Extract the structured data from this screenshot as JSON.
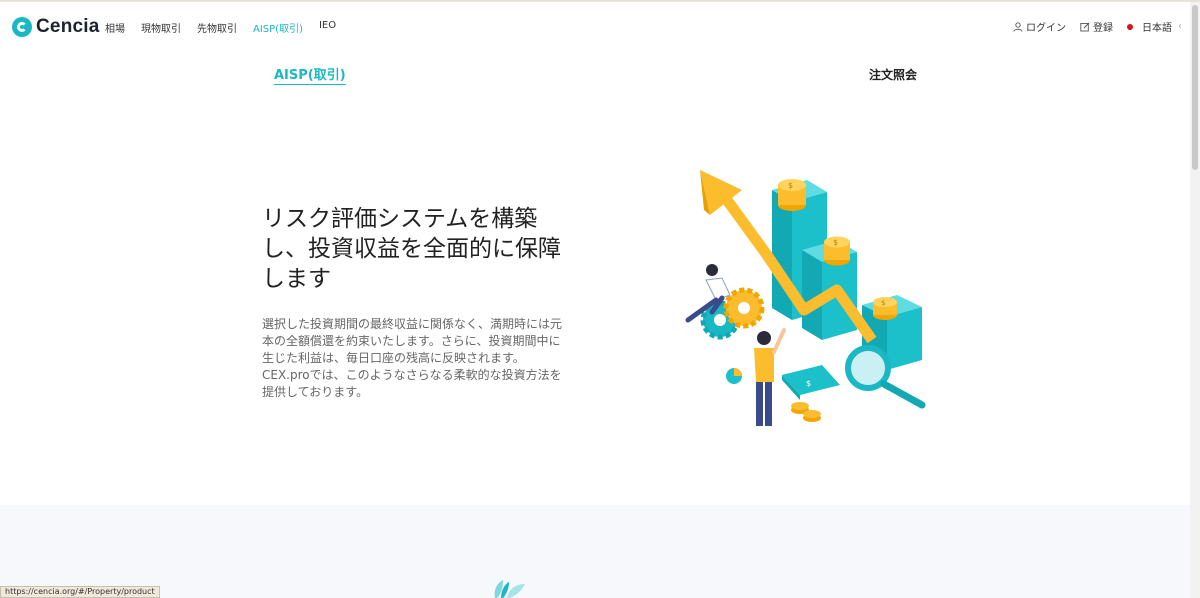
{
  "header": {
    "logo_text": "Cencia",
    "nav": [
      {
        "label": "相場"
      },
      {
        "label": "現物取引"
      },
      {
        "label": "先物取引"
      },
      {
        "label": "AISP(取引)"
      },
      {
        "label": "IEO"
      }
    ],
    "login_label": "ログイン",
    "register_label": "登録",
    "language_label": "日本語"
  },
  "tabs": {
    "left": "AISP(取引)",
    "right": "注文照会"
  },
  "hero": {
    "title": "リスク評価システムを構築し、投資収益を全面的に保障します",
    "description": "選択した投資期間の最終収益に関係なく、満期時には元本の全額償還を約束いたします。さらに、投資期間中に生じた利益は、毎日口座の残高に反映されます。CEX.proでは、このようなさらなる柔軟的な投資方法を提供しております。"
  },
  "status_bar": {
    "url": "https://cencia.org/#/Property/product"
  },
  "colors": {
    "accent": "#1ab8c4",
    "arrow": "#fbbd2e",
    "bottom_bg": "#f7f8fb"
  },
  "icons": {
    "logo": "cencia-logo-icon",
    "login": "user-icon",
    "register": "edit-icon",
    "language": "flag-dot-icon"
  }
}
